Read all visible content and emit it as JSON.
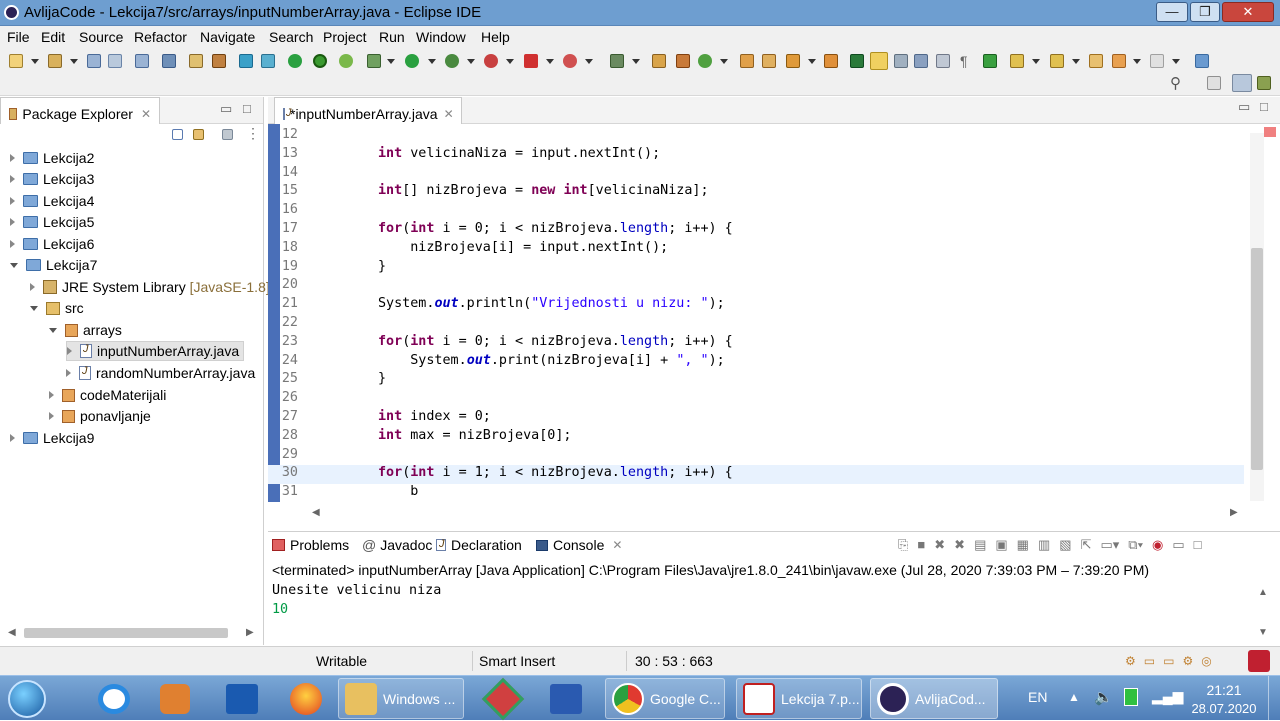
{
  "window": {
    "title": "AvlijaCode - Lekcija7/src/arrays/inputNumberArray.java - Eclipse IDE",
    "buttons": {
      "minimize": "—",
      "maximize": "❐",
      "close": "✕"
    }
  },
  "menubar": [
    "File",
    "Edit",
    "Source",
    "Refactor",
    "Navigate",
    "Search",
    "Project",
    "Run",
    "Window",
    "Help"
  ],
  "package_explorer": {
    "title": "Package Explorer",
    "tree": [
      {
        "label": "Lekcija2",
        "type": "project",
        "expanded": false
      },
      {
        "label": "Lekcija3",
        "type": "project",
        "expanded": false
      },
      {
        "label": "Lekcija4",
        "type": "project",
        "expanded": false
      },
      {
        "label": "Lekcija5",
        "type": "project",
        "expanded": false
      },
      {
        "label": "Lekcija6",
        "type": "project",
        "expanded": false
      },
      {
        "label": "Lekcija7",
        "type": "project",
        "expanded": true
      },
      {
        "label": "JRE System Library",
        "suffix": "[JavaSE-1.8]",
        "type": "library",
        "expanded": false
      },
      {
        "label": "src",
        "type": "source-folder",
        "expanded": true
      },
      {
        "label": "arrays",
        "type": "package",
        "expanded": true
      },
      {
        "label": "inputNumberArray.java",
        "type": "java-file",
        "expanded": false,
        "selected": true
      },
      {
        "label": "randomNumberArray.java",
        "type": "java-file",
        "expanded": false
      },
      {
        "label": "codeMaterijali",
        "type": "package",
        "expanded": false
      },
      {
        "label": "ponavljanje",
        "type": "package",
        "expanded": false
      },
      {
        "label": "Lekcija9",
        "type": "project",
        "expanded": false
      }
    ]
  },
  "editor": {
    "tab_label": "*inputNumberArray.java",
    "current_line": 30,
    "lines": [
      {
        "n": "12",
        "code": ""
      },
      {
        "n": "13",
        "code": "int velicinaNiza = input.nextInt();"
      },
      {
        "n": "14",
        "code": ""
      },
      {
        "n": "15",
        "code": "int[] nizBrojeva = new int[velicinaNiza];"
      },
      {
        "n": "16",
        "code": ""
      },
      {
        "n": "17",
        "code": "for(int i = 0; i < nizBrojeva.length; i++) {"
      },
      {
        "n": "18",
        "code": "    nizBrojeva[i] = input.nextInt();"
      },
      {
        "n": "19",
        "code": "}"
      },
      {
        "n": "20",
        "code": ""
      },
      {
        "n": "21",
        "code": "System.out.println(\"Vrijednosti u nizu: \");"
      },
      {
        "n": "22",
        "code": ""
      },
      {
        "n": "23",
        "code": "for(int i = 0; i < nizBrojeva.length; i++) {"
      },
      {
        "n": "24",
        "code": "    System.out.print(nizBrojeva[i] + \", \");"
      },
      {
        "n": "25",
        "code": "}"
      },
      {
        "n": "26",
        "code": ""
      },
      {
        "n": "27",
        "code": "int index = 0;"
      },
      {
        "n": "28",
        "code": "int max = nizBrojeva[0];"
      },
      {
        "n": "29",
        "code": ""
      },
      {
        "n": "30",
        "code": "for(int i = 1; i < nizBrojeva.length; i++) {"
      },
      {
        "n": "31",
        "code": "    b"
      }
    ]
  },
  "console": {
    "tabs": [
      "Problems",
      "Javadoc",
      "Declaration",
      "Console"
    ],
    "active_tab": "Console",
    "header": "<terminated> inputNumberArray [Java Application] C:\\Program Files\\Java\\jre1.8.0_241\\bin\\javaw.exe  (Jul 28, 2020 7:39:03 PM – 7:39:20 PM)",
    "output": [
      {
        "text": "Unesite velicinu niza",
        "color": "#000000"
      },
      {
        "text": "10",
        "color": "#009a45"
      }
    ]
  },
  "statusbar": {
    "writable": "Writable",
    "insert_mode": "Smart Insert",
    "position": "30 : 53 : 663"
  },
  "taskbar": {
    "items": [
      {
        "label": "",
        "icon": "windows-start-icon"
      },
      {
        "label": "",
        "icon": "internet-explorer-icon"
      },
      {
        "label": "",
        "icon": "media-player-icon"
      },
      {
        "label": "",
        "icon": "outlook-icon"
      },
      {
        "label": "",
        "icon": "firefox-icon"
      },
      {
        "label": "Windows ...",
        "icon": "explorer-folder-icon"
      },
      {
        "label": "",
        "icon": "git-icon"
      },
      {
        "label": "",
        "icon": "word-icon"
      },
      {
        "label": "Google C...",
        "icon": "chrome-icon"
      },
      {
        "label": "Lekcija 7.p...",
        "icon": "pdf-icon"
      },
      {
        "label": "AvlijaCod...",
        "icon": "eclipse-icon"
      }
    ],
    "lang": "EN",
    "time": "21:21",
    "date": "28.07.2020"
  },
  "colors": {
    "keyword": "#7f0055",
    "field": "#0000c0",
    "string": "#2a00ff",
    "current_line": "#e8f2fe",
    "console_input": "#009a45"
  }
}
